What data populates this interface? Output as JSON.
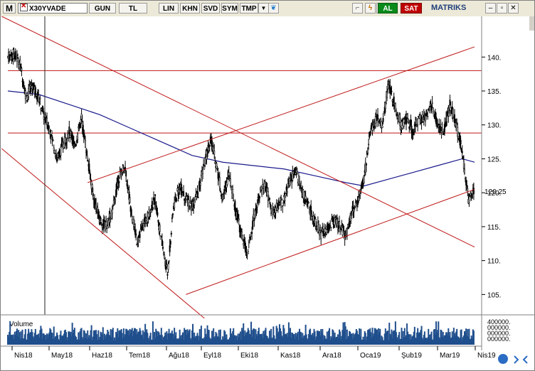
{
  "toolbar": {
    "m_label": "M",
    "symbol": "X30YVADE",
    "period": "GUN",
    "currency": "TL",
    "scale": "LIN",
    "khn": "KHN",
    "svd": "SVD",
    "sym": "SYM",
    "tmp": "TMP",
    "buy": "AL",
    "sell": "SAT",
    "brand": "MATRIKS",
    "colors": {
      "buy": "#0b8a1a",
      "sell": "#c00000"
    }
  },
  "chart_data": {
    "type": "candlestick",
    "y_ticks": [
      "140.",
      "135.",
      "130.",
      "125.",
      "120.",
      "115.",
      "110.",
      "105."
    ],
    "ylim": [
      102,
      146
    ],
    "last_price": "120.25",
    "x_ticks": [
      "Nis18",
      "May18",
      "Haz18",
      "Tem18",
      "Ağu18",
      "Eyl18",
      "Eki18",
      "Kas18",
      "Ara18",
      "Oca19",
      "Şub19",
      "Mar19",
      "Nis19"
    ],
    "volume_label": "Volume",
    "volume_ticks": [
      "400000.",
      "000000.",
      "000000.",
      "000000."
    ],
    "price_path": [
      [
        0,
        140
      ],
      [
        1,
        140.5
      ],
      [
        2,
        139
      ],
      [
        3,
        134
      ],
      [
        4,
        136
      ],
      [
        5,
        134
      ],
      [
        6,
        131
      ],
      [
        7,
        129
      ],
      [
        8,
        125
      ],
      [
        9,
        127
      ],
      [
        10,
        129
      ],
      [
        11,
        127
      ],
      [
        12,
        131
      ],
      [
        13,
        125
      ],
      [
        14,
        119
      ],
      [
        15,
        116
      ],
      [
        16,
        115
      ],
      [
        17,
        117
      ],
      [
        18,
        122
      ],
      [
        19,
        124
      ],
      [
        20,
        118
      ],
      [
        21,
        113
      ],
      [
        22,
        115
      ],
      [
        23,
        117
      ],
      [
        24,
        119
      ],
      [
        25,
        113
      ],
      [
        26,
        108
      ],
      [
        27,
        118
      ],
      [
        28,
        121
      ],
      [
        29,
        119
      ],
      [
        30,
        118
      ],
      [
        31,
        120
      ],
      [
        32,
        124
      ],
      [
        33,
        128
      ],
      [
        34,
        124
      ],
      [
        35,
        119
      ],
      [
        36,
        123
      ],
      [
        37,
        118
      ],
      [
        38,
        114
      ],
      [
        39,
        111
      ],
      [
        40,
        116
      ],
      [
        41,
        120
      ],
      [
        42,
        121
      ],
      [
        43,
        117
      ],
      [
        44,
        118
      ],
      [
        45,
        119
      ],
      [
        46,
        122
      ],
      [
        47,
        123
      ],
      [
        48,
        120
      ],
      [
        49,
        118
      ],
      [
        50,
        116
      ],
      [
        51,
        114
      ],
      [
        52,
        114.5
      ],
      [
        53,
        116
      ],
      [
        54,
        115
      ],
      [
        55,
        113.5
      ],
      [
        56,
        117
      ],
      [
        57,
        119
      ],
      [
        58,
        122
      ],
      [
        59,
        129
      ],
      [
        60,
        131
      ],
      [
        61,
        130
      ],
      [
        62,
        136
      ],
      [
        63,
        133
      ],
      [
        64,
        130
      ],
      [
        65,
        131
      ],
      [
        66,
        129
      ],
      [
        67,
        131
      ],
      [
        68,
        131
      ],
      [
        69,
        133
      ],
      [
        70,
        130
      ],
      [
        71,
        129
      ],
      [
        72,
        133
      ],
      [
        73,
        130
      ],
      [
        74,
        126
      ],
      [
        75,
        119
      ],
      [
        76,
        120.25
      ]
    ],
    "ma_path": [
      [
        0,
        135
      ],
      [
        5,
        134.5
      ],
      [
        10,
        133
      ],
      [
        15,
        131.5
      ],
      [
        20,
        129.5
      ],
      [
        25,
        127.5
      ],
      [
        30,
        125.5
      ],
      [
        35,
        124.5
      ],
      [
        40,
        124
      ],
      [
        45,
        123.5
      ],
      [
        50,
        122.5
      ],
      [
        55,
        121.5
      ],
      [
        58,
        121
      ],
      [
        62,
        122
      ],
      [
        66,
        123
      ],
      [
        70,
        124
      ],
      [
        74,
        125
      ],
      [
        76,
        124.5
      ]
    ],
    "horizontal_lines": [
      138,
      128.8
    ],
    "trend_lines": [
      [
        [
          -1,
          146
        ],
        [
          76,
          112
        ]
      ],
      [
        [
          -1,
          126.5
        ],
        [
          32,
          101.5
        ]
      ],
      [
        [
          13,
          121.5
        ],
        [
          76,
          141.5
        ]
      ],
      [
        [
          29,
          105
        ],
        [
          76,
          120.5
        ]
      ]
    ],
    "colors": {
      "candle": "#000000",
      "ma": "#1a1a8c",
      "trend": "#c01818",
      "volume": "#1f4e8c",
      "grid": "#c8c8c8"
    }
  }
}
